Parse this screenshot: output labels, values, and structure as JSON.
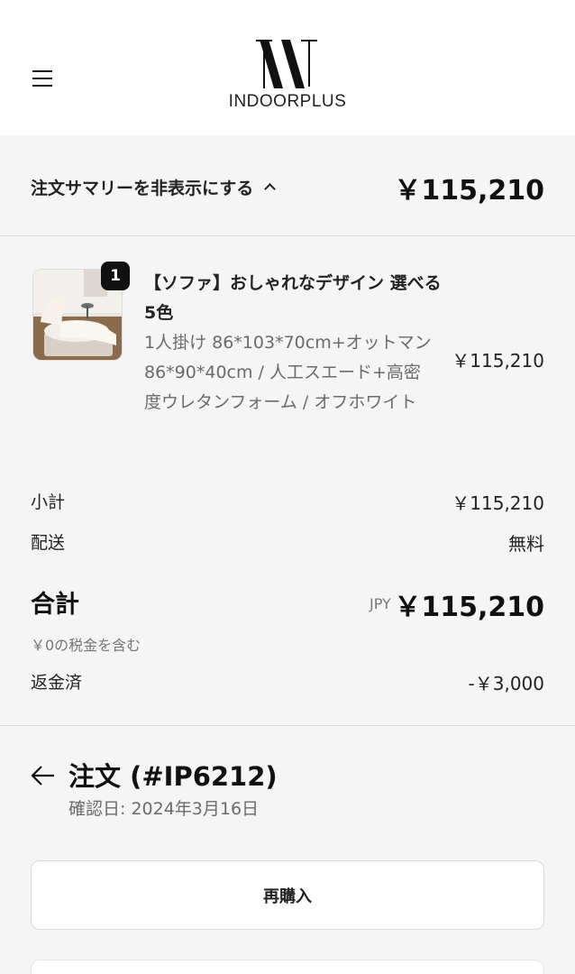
{
  "header": {
    "brand": "INDOORPLUS",
    "menu_icon": "hamburger-menu-icon",
    "logo_icon": "indoorplus-logo-mark"
  },
  "summary": {
    "toggle_label": "注文サマリーを非表示にする",
    "toggle_icon": "chevron-up-icon",
    "total": "￥115,210"
  },
  "product": {
    "quantity": "1",
    "name": "【ソファ】おしゃれなデザイン 選べる5色",
    "variant": "1人掛け 86*103*70cm+オットマン 86*90*40cm / 人工スエード+高密度ウレタンフォーム / オフホワイト",
    "price": "￥115,210"
  },
  "costs": {
    "subtotal_label": "小計",
    "subtotal_value": "￥115,210",
    "shipping_label": "配送",
    "shipping_value": "無料",
    "total_label": "合計",
    "total_currency": "JPY",
    "total_value": "￥115,210",
    "tax_note": "￥0の税金を含む",
    "refund_label": "返金済",
    "refund_value": "-￥3,000"
  },
  "order": {
    "back_icon": "arrow-left-icon",
    "title": "注文 (#IP6212)",
    "confirmed_date": "確認日: 2024年3月16日",
    "rebuy_label": "再購入"
  },
  "colors": {
    "background": "#f5f5f5",
    "header_bg": "#ffffff",
    "text": "#111111",
    "muted": "#6b6b6b",
    "badge_bg": "#111111"
  }
}
